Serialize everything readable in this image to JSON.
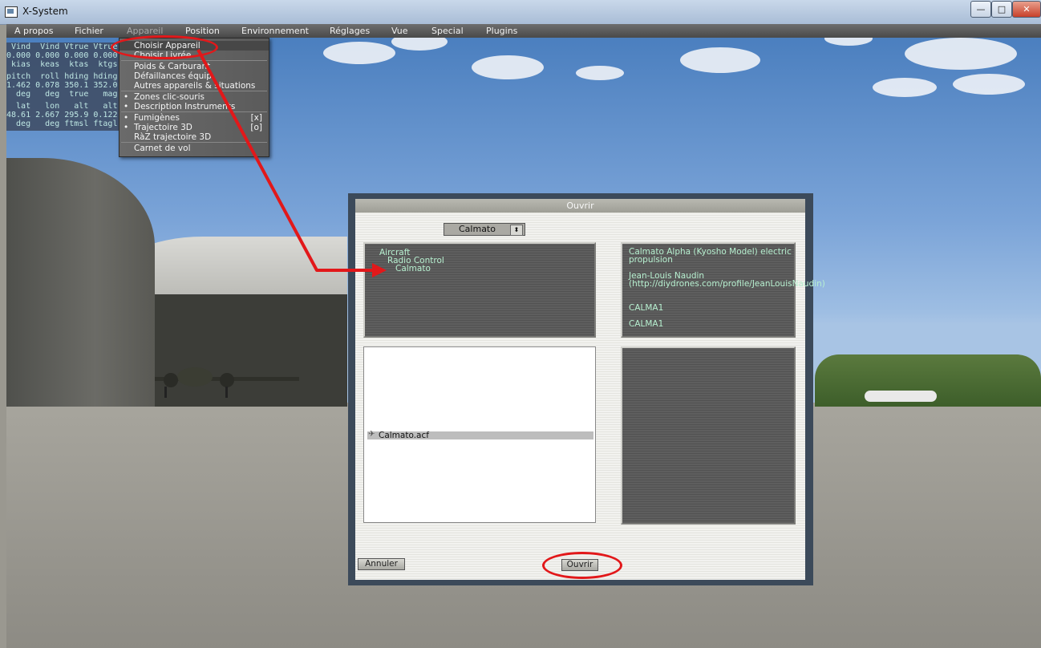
{
  "window": {
    "title": "X-System",
    "minimize": "—",
    "maximize": "□",
    "close": "✕"
  },
  "menu": [
    {
      "label": "A propos"
    },
    {
      "label": "Fichier"
    },
    {
      "label": "Appareil"
    },
    {
      "label": "Position"
    },
    {
      "label": "Environnement"
    },
    {
      "label": "Réglages"
    },
    {
      "label": "Vue"
    },
    {
      "label": "Special"
    },
    {
      "label": "Plugins"
    }
  ],
  "hud": {
    "lines": [
      " Vind  Vind Vtrue Vtrue",
      "0.000 0.000 0.000 0.000",
      " kias  keas  ktas  ktgs",
      "pitch  roll hding hding",
      "1.462 0.078 350.1 352.0",
      "  deg   deg  true   mag",
      "  lat   lon   alt   alt",
      "48.61 2.667 295.9 0.122",
      "  deg   deg ftmsl ftagl"
    ]
  },
  "dropdown": {
    "items": [
      {
        "label": "Choisir Appareil",
        "bullet": "",
        "key": ""
      },
      {
        "label": "Choisir Livrée",
        "bullet": "",
        "key": ""
      },
      {
        "label": "Poids & Carburant",
        "bullet": "",
        "key": ""
      },
      {
        "label": "Défaillances équip.",
        "bullet": "",
        "key": ""
      },
      {
        "label": "Autres appareils & situations",
        "bullet": "",
        "key": ""
      },
      {
        "label": "Zones  clic-souris",
        "bullet": "•",
        "key": ""
      },
      {
        "label": "Description Instruments",
        "bullet": "•",
        "key": ""
      },
      {
        "label": "Fumigènes",
        "bullet": "•",
        "key": "[x]"
      },
      {
        "label": "Trajectoire 3D",
        "bullet": "•",
        "key": "[o]"
      },
      {
        "label": "RàZ trajectoire 3D",
        "bullet": "",
        "key": ""
      },
      {
        "label": "Carnet de vol",
        "bullet": "",
        "key": ""
      }
    ]
  },
  "dialog": {
    "title": "Ouvrir",
    "selector_value": "Calmato",
    "selector_arrow": "⬍",
    "tree": [
      "Aircraft",
      "Radio Control",
      "Calmato"
    ],
    "info": {
      "description": "Calmato Alpha (Kyosho Model) electric propulsion",
      "author": "Jean-Louis Naudin (http://diydrones.com/profile/JeanLouisNaudin)",
      "code1": "CALMA1",
      "code2": "CALMA1"
    },
    "file": "Calmato.acf",
    "file_icon": "✈",
    "cancel_label": "Annuler",
    "open_label": "Ouvrir"
  },
  "colors": {
    "annotation": "#e2181a",
    "panel_text": "#b7f0d0"
  }
}
